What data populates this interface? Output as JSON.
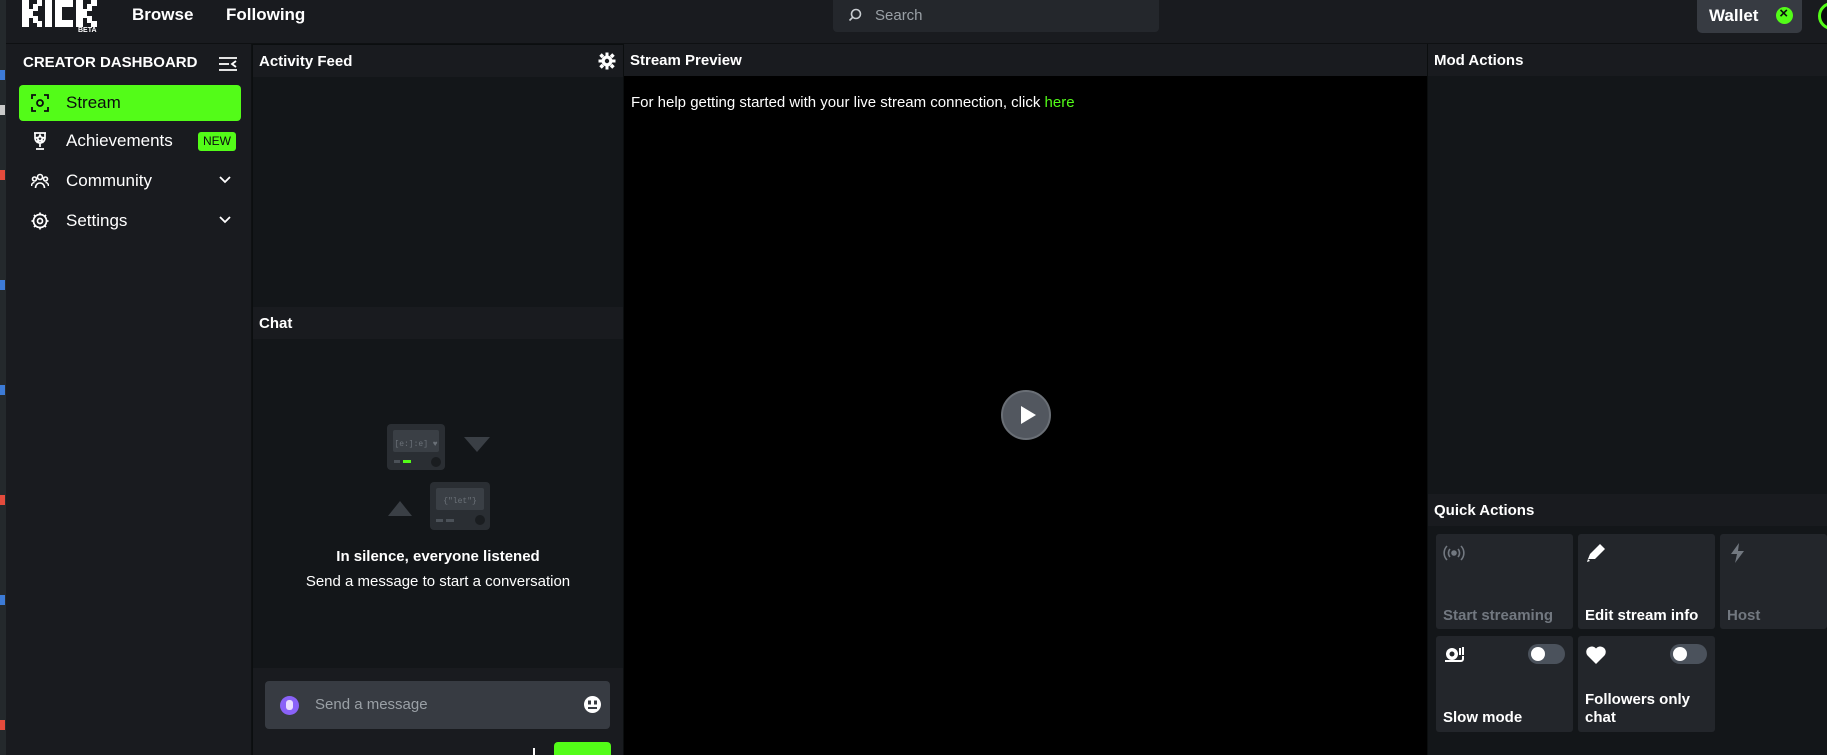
{
  "nav": {
    "logo_text": "KICK",
    "logo_badge": "BETA",
    "browse": "Browse",
    "following": "Following",
    "search_placeholder": "Search",
    "wallet": "Wallet"
  },
  "sidebar": {
    "title": "CREATOR DASHBOARD",
    "items": [
      {
        "label": "Stream",
        "icon": "stream-icon",
        "active": true
      },
      {
        "label": "Achievements",
        "icon": "trophy-icon",
        "badge": "NEW"
      },
      {
        "label": "Community",
        "icon": "community-icon",
        "expandable": true
      },
      {
        "label": "Settings",
        "icon": "settings-icon",
        "expandable": true
      }
    ]
  },
  "panels": {
    "activity_feed": "Activity Feed",
    "chat": "Chat",
    "stream_preview": "Stream Preview",
    "mod_actions": "Mod Actions",
    "quick_actions": "Quick Actions"
  },
  "chat": {
    "empty_title": "In silence, everyone listened",
    "empty_subtitle": "Send a message to start a conversation",
    "input_placeholder": "Send a message"
  },
  "stream": {
    "help_text": "For help getting started with your live stream connection, click ",
    "help_link": "here"
  },
  "quick_actions": [
    {
      "label": "Start streaming",
      "icon": "broadcast-icon",
      "enabled": false
    },
    {
      "label": "Edit stream info",
      "icon": "pencil-icon",
      "enabled": true
    },
    {
      "label": "Host",
      "icon": "lightning-icon",
      "enabled": false
    },
    {
      "label": "Slow mode",
      "icon": "snail-icon",
      "toggle": false
    },
    {
      "label": "Followers only chat",
      "icon": "heart-icon",
      "toggle": false
    }
  ],
  "colors": {
    "accent": "#53fc18",
    "panel": "#191b1f",
    "panel_body": "#131619",
    "video_bg": "#000000"
  }
}
